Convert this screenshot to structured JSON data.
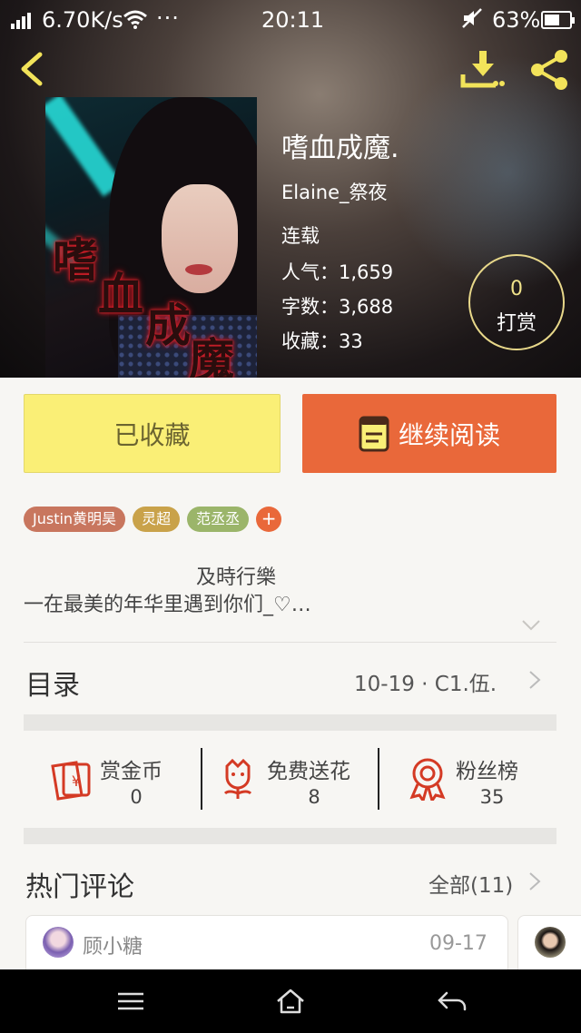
{
  "status_bar": {
    "speed": "6.70K/s",
    "dots": "···",
    "time": "20:11",
    "battery_pct": "63%",
    "battery_level": 0.63
  },
  "header": {
    "back_icon": "chevron-left-icon",
    "download_icon": "download-icon",
    "share_icon": "share-icon"
  },
  "book": {
    "cover_text": [
      "嗜",
      "血",
      "成",
      "魔"
    ],
    "title": "嗜血成魔.",
    "author": "Elaine_祭夜",
    "status": "连载",
    "popularity": "人气：1,659",
    "word_count": "字数：3,688",
    "favorites": "收藏：33"
  },
  "tip": {
    "count": "0",
    "label": "打赏"
  },
  "actions": {
    "favorite_label": "已收藏",
    "read_label": "继续阅读"
  },
  "tags": [
    {
      "label": "Justin黄明昊",
      "color": "#c8765e"
    },
    {
      "label": "灵超",
      "color": "#c9a24a"
    },
    {
      "label": "范丞丞",
      "color": "#9bb56a"
    }
  ],
  "tag_add": "+",
  "intro": {
    "line1": "及時行樂",
    "line2": "一在最美的年华里遇到你们_♡…"
  },
  "toc": {
    "label": "目录",
    "latest": "10-19 · C1.伍."
  },
  "stats": [
    {
      "label": "赏金币",
      "value": "0",
      "icon": "red-envelope-icon"
    },
    {
      "label": "免费送花",
      "value": "8",
      "icon": "flower-icon"
    },
    {
      "label": "粉丝榜",
      "value": "35",
      "icon": "medal-icon"
    }
  ],
  "comments": {
    "label": "热门评论",
    "all": "全部(11)",
    "first": {
      "user": "顾小糖",
      "date": "09-17"
    }
  },
  "colors": {
    "accent_orange": "#e9683a",
    "favorite_yellow": "#faef76",
    "icon_red": "#d43a24",
    "header_yellow": "#f2e35a"
  }
}
